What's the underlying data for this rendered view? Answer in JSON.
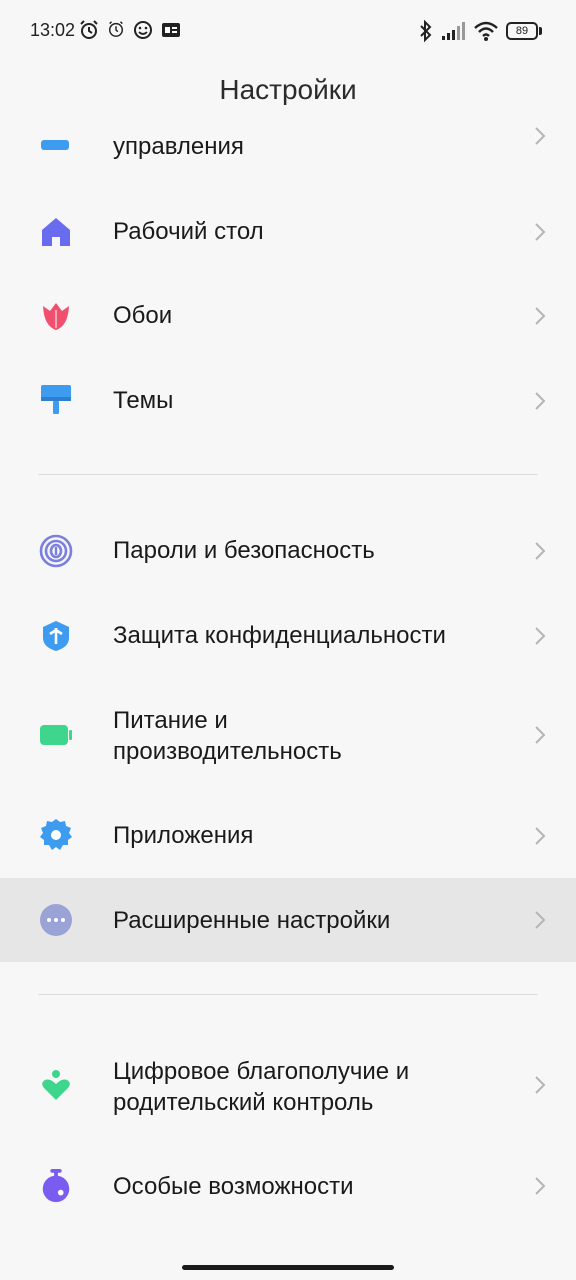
{
  "status_bar": {
    "time": "13:02",
    "battery": "89",
    "left_icons": [
      "alarm-icon",
      "alarm-clock-icon",
      "emoji-notification-icon",
      "card-notification-icon"
    ],
    "right_icons": [
      "bluetooth-icon",
      "signal-icon",
      "wifi-icon",
      "battery-icon"
    ]
  },
  "header": {
    "title": "Настройки"
  },
  "items": [
    {
      "label": "управления",
      "icon": "control-center-icon",
      "color": "#3d9bf0"
    },
    {
      "label": "Рабочий стол",
      "icon": "home-icon",
      "color": "#6a6cf0"
    },
    {
      "label": "Обои",
      "icon": "tulip-icon",
      "color": "#f0506e"
    },
    {
      "label": "Темы",
      "icon": "paint-roller-icon",
      "color": "#3d9bf0"
    },
    {
      "label": "Пароли и безопасность",
      "icon": "fingerprint-icon",
      "color": "#7b7fe0"
    },
    {
      "label": "Защита конфиденциальности",
      "icon": "privacy-shield-icon",
      "color": "#3d9bf0"
    },
    {
      "label_line1": "Питание и",
      "label_line2": "производительность",
      "icon": "battery-power-icon",
      "color": "#3ed68c"
    },
    {
      "label": "Приложения",
      "icon": "apps-gear-icon",
      "color": "#3d9bf0"
    },
    {
      "label": "Расширенные настройки",
      "icon": "more-dots-icon",
      "color": "#9aa3d6"
    },
    {
      "label_line1": "Цифровое благополучие и",
      "label_line2": "родительский контроль",
      "icon": "wellbeing-icon",
      "color": "#3ed68c"
    },
    {
      "label": "Особые возможности",
      "icon": "accessibility-icon",
      "color": "#7b5cf0"
    }
  ]
}
